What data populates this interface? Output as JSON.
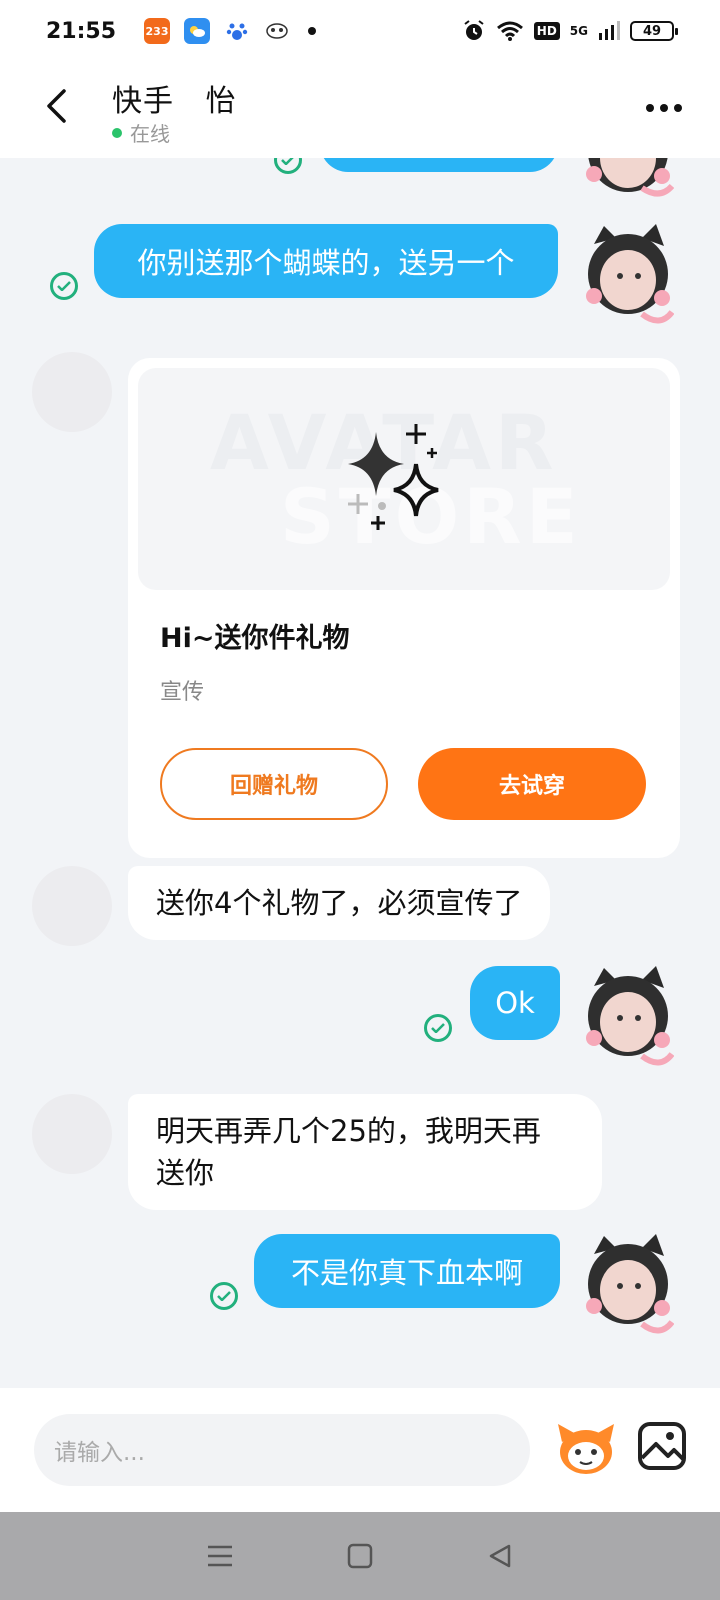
{
  "status_bar": {
    "time": "21:55",
    "app_badge": "233",
    "hd": "HD",
    "network": "5G",
    "battery": "49"
  },
  "header": {
    "title": "快手   怡",
    "status": "在线"
  },
  "messages": [
    {
      "from": "me",
      "text": "你别送那个蝴蝶的，送另一个"
    },
    {
      "from": "other",
      "type": "gift_card",
      "banner_line1": "AVATAR",
      "banner_line2": "STORE",
      "title": "Hi~送你件礼物",
      "subtitle": "宣传",
      "button_return": "回赠礼物",
      "button_try": "去试穿"
    },
    {
      "from": "other",
      "text": "送你4个礼物了，必须宣传了"
    },
    {
      "from": "me",
      "text": "Ok"
    },
    {
      "from": "other",
      "text_line1": "明天再弄几个25的，我明天再",
      "text_line2": "送你"
    },
    {
      "from": "me",
      "text": "不是你真下血本啊"
    }
  ],
  "input": {
    "placeholder": "请输入..."
  },
  "colors": {
    "bubble_out": "#2ab4f5",
    "accent_orange": "#ff7414",
    "online": "#2bc36b",
    "read_check": "#22b07d"
  }
}
